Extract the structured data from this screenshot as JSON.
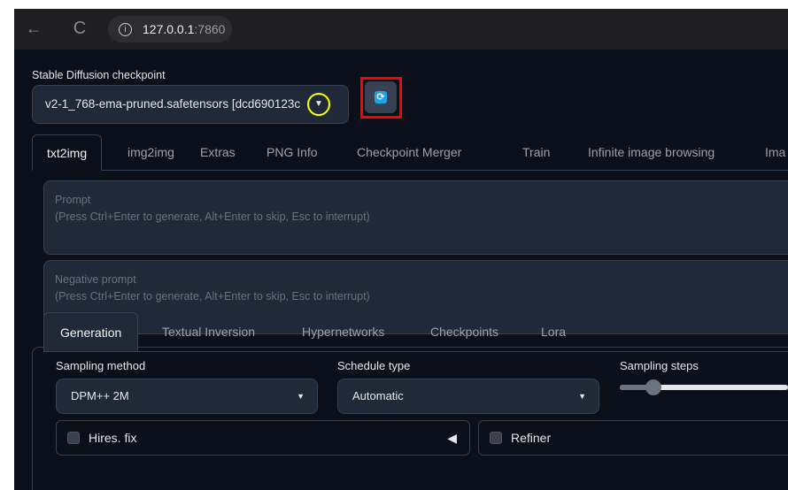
{
  "browser": {
    "back_icon": "←",
    "reload_icon": "C",
    "info_icon": "i",
    "url_host": "127.0.0.1",
    "url_port": ":7860"
  },
  "checkpoint": {
    "label": "Stable Diffusion checkpoint",
    "value": "v2-1_768-ema-pruned.safetensors [dcd690123c",
    "arrow_icon": "▼",
    "refresh_icon": "⟳"
  },
  "tabs": [
    {
      "label": "txt2img",
      "active": true
    },
    {
      "label": "img2img"
    },
    {
      "label": "Extras"
    },
    {
      "label": "PNG Info"
    },
    {
      "label": "Checkpoint Merger"
    },
    {
      "label": "Train"
    },
    {
      "label": "Infinite image browsing"
    },
    {
      "label": "Ima"
    }
  ],
  "prompt": {
    "title": "Prompt",
    "hint": "(Press Ctrl+Enter to generate, Alt+Enter to skip, Esc to interrupt)"
  },
  "negative_prompt": {
    "title": "Negative prompt",
    "hint": "(Press Ctrl+Enter to generate, Alt+Enter to skip, Esc to interrupt)"
  },
  "subtabs": [
    {
      "label": "Generation",
      "active": true
    },
    {
      "label": "Textual Inversion"
    },
    {
      "label": "Hypernetworks"
    },
    {
      "label": "Checkpoints"
    },
    {
      "label": "Lora"
    }
  ],
  "sampling_method": {
    "label": "Sampling method",
    "value": "DPM++ 2M"
  },
  "schedule_type": {
    "label": "Schedule type",
    "value": "Automatic"
  },
  "sampling_steps": {
    "label": "Sampling steps",
    "fraction": 0.2
  },
  "hires_fix": {
    "label": "Hires. fix",
    "collapse_icon": "◀"
  },
  "refiner": {
    "label": "Refiner"
  },
  "colors": {
    "background": "#0b0f19",
    "panel": "#1f2937",
    "border": "#374151",
    "accent": "#1ca3ec",
    "highlight_red": "#ff0000",
    "highlight_yellow": "#ffff00"
  }
}
